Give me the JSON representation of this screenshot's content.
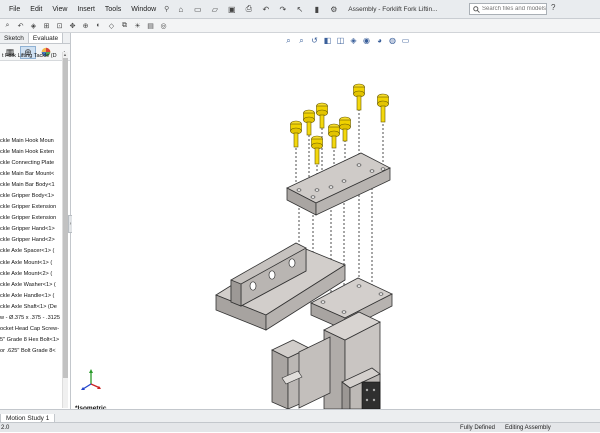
{
  "menubar": {
    "items": [
      "File",
      "Edit",
      "View",
      "Insert",
      "Tools",
      "Window"
    ],
    "title": "Assembly - Forklift Fork Liftin...",
    "search_placeholder": "Search files and models",
    "help_icon": "question-mark-icon"
  },
  "sidebar": {
    "tabs": [
      "Sketch",
      "Evaluate"
    ],
    "root": "t Fork Lifting Tackle  (D",
    "items": [
      "ckle Main Hook Moun",
      "ckle Main Hook Exten",
      "ckle Connecting Plate",
      "ckle Main Bar Mount<",
      "ckle Main Bar Body<1",
      "ckle Gripper Body<1>",
      "ckle Gripper Extension",
      "ckle Gripper Extension",
      "ckle Gripper Hand<1>",
      "ckle Gripper Hand<2>",
      "ckle Axle Spacer<1> (",
      "ckle Axle Mount<1> (",
      "ckle Axle Mount<2> (",
      "ckle Axle Washer<1> (",
      "ckle Axle Handle<1> (",
      "ckle Axle Shaft<1> (De",
      "w - Ø.375 x .375 - .3125",
      "ocket Head Cap Screw-",
      "5\" Grade 8 Hex Bolt<1>",
      "or .625\" Bolt Grade 8<"
    ]
  },
  "viewport": {
    "view_label": "*Isometric",
    "triad_labels": {
      "x": "X",
      "y": "Y",
      "z": "Z"
    }
  },
  "bottom": {
    "tab": "Motion Study 1"
  },
  "status": {
    "left": "2.0",
    "mid": "Fully Defined",
    "right": "Editing Assembly"
  },
  "colors": {
    "bolt": "#f0d200",
    "steel": "#c8c4c1",
    "steel_dark": "#8c8885"
  }
}
